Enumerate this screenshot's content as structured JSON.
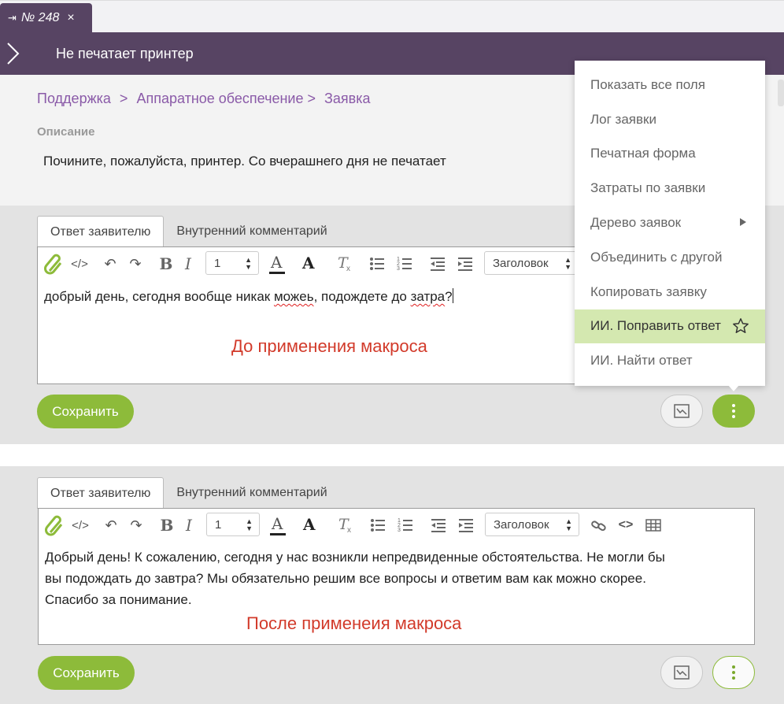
{
  "doc_tab": {
    "pin": "⇥",
    "label": "№ 248",
    "close": "×"
  },
  "header": {
    "title": "Не печатает принтер"
  },
  "breadcrumb": {
    "items": [
      "Поддержка",
      ">",
      "Аппаратное обеспечение >",
      "Заявка"
    ]
  },
  "description": {
    "label": "Описание",
    "text": "Почините, пожалуйста, принтер. Со вчерашнего дня не печатает"
  },
  "tabs": {
    "reply": "Ответ заявителю",
    "internal": "Внутренний комментарий"
  },
  "toolbar": {
    "font_size": "1",
    "heading": "Заголовок"
  },
  "panel_before": {
    "text_a": "добрый день, сегодня вообще никак ",
    "word_mistake1": "можеь",
    "text_b": ", подождете до ",
    "word_mistake2": "затра",
    "text_c": "?",
    "macro_label": "До применения макроса"
  },
  "panel_after": {
    "line1": "Добрый день! К сожалению, сегодня у нас возникли непредвиденные обстоятельства. Не могли бы",
    "line2": "вы подождать до завтра? Мы обязательно решим все вопросы и ответим вам как можно скорее.",
    "line3": "Спасибо за понимание.",
    "macro_label": "После применеия макроса"
  },
  "buttons": {
    "save": "Сохранить"
  },
  "menu": {
    "items": [
      "Показать все поля",
      "Лог заявки",
      "Печатная форма",
      "Затраты по заявки",
      "Дерево заявок",
      "Объединить с другой",
      "Копировать заявку",
      "ИИ. Поправить ответ",
      "ИИ. Найти ответ"
    ]
  },
  "colors": {
    "header_bg": "#574463",
    "breadcrumb": "#8a5aa8",
    "accent_green": "#8dbb3a",
    "menu_highlight": "#d4e8b0",
    "macro_label": "#d23a2a"
  }
}
